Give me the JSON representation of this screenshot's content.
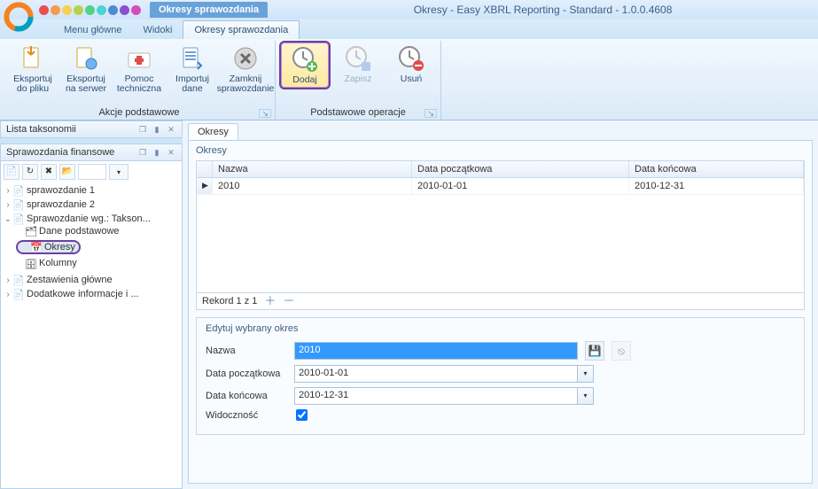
{
  "window": {
    "title": "Okresy - Easy XBRL Reporting - Standard - 1.0.0.4608"
  },
  "context_tab": "Okresy sprawozdania",
  "menu_tabs": {
    "main": "Menu główne",
    "views": "Widoki",
    "active": "Okresy sprawozdania"
  },
  "ribbon": {
    "group_core": {
      "label": "Akcje podstawowe",
      "export_file": "Eksportuj\ndo pliku",
      "export_server": "Eksportuj\nna serwer",
      "tech_support": "Pomoc\ntechniczna",
      "import_data": "Importuj\ndane",
      "close_report": "Zamknij\nsprawozdanie"
    },
    "group_ops": {
      "label": "Podstawowe operacje",
      "add": "Dodaj",
      "save": "Zapisz",
      "delete": "Usuń"
    }
  },
  "left": {
    "taxonomy_panel": "Lista taksonomii",
    "reports_panel": "Sprawozdania finansowe",
    "tree": {
      "n1": "sprawozdanie 1",
      "n2": "sprawozdanie 2",
      "n3": "Sprawozdanie wg.: Takson...",
      "n3a": "Dane podstawowe",
      "n3b": "Okresy",
      "n3c": "Kolumny",
      "n4": "Zestawienia główne",
      "n5": "Dodatkowe informacje i ..."
    }
  },
  "doc": {
    "tab": "Okresy",
    "panel_title": "Okresy",
    "columns": {
      "name": "Nazwa",
      "start": "Data początkowa",
      "end": "Data końcowa"
    },
    "rows": [
      {
        "name": "2010",
        "start": "2010-01-01",
        "end": "2010-12-31"
      }
    ],
    "record_status": "Rekord 1 z 1",
    "edit": {
      "title": "Edytuj wybrany okres",
      "l_name": "Nazwa",
      "l_start": "Data początkowa",
      "l_end": "Data końcowa",
      "l_vis": "Widoczność",
      "v_name": "2010",
      "v_start": "2010-01-01",
      "v_end": "2010-12-31"
    }
  }
}
